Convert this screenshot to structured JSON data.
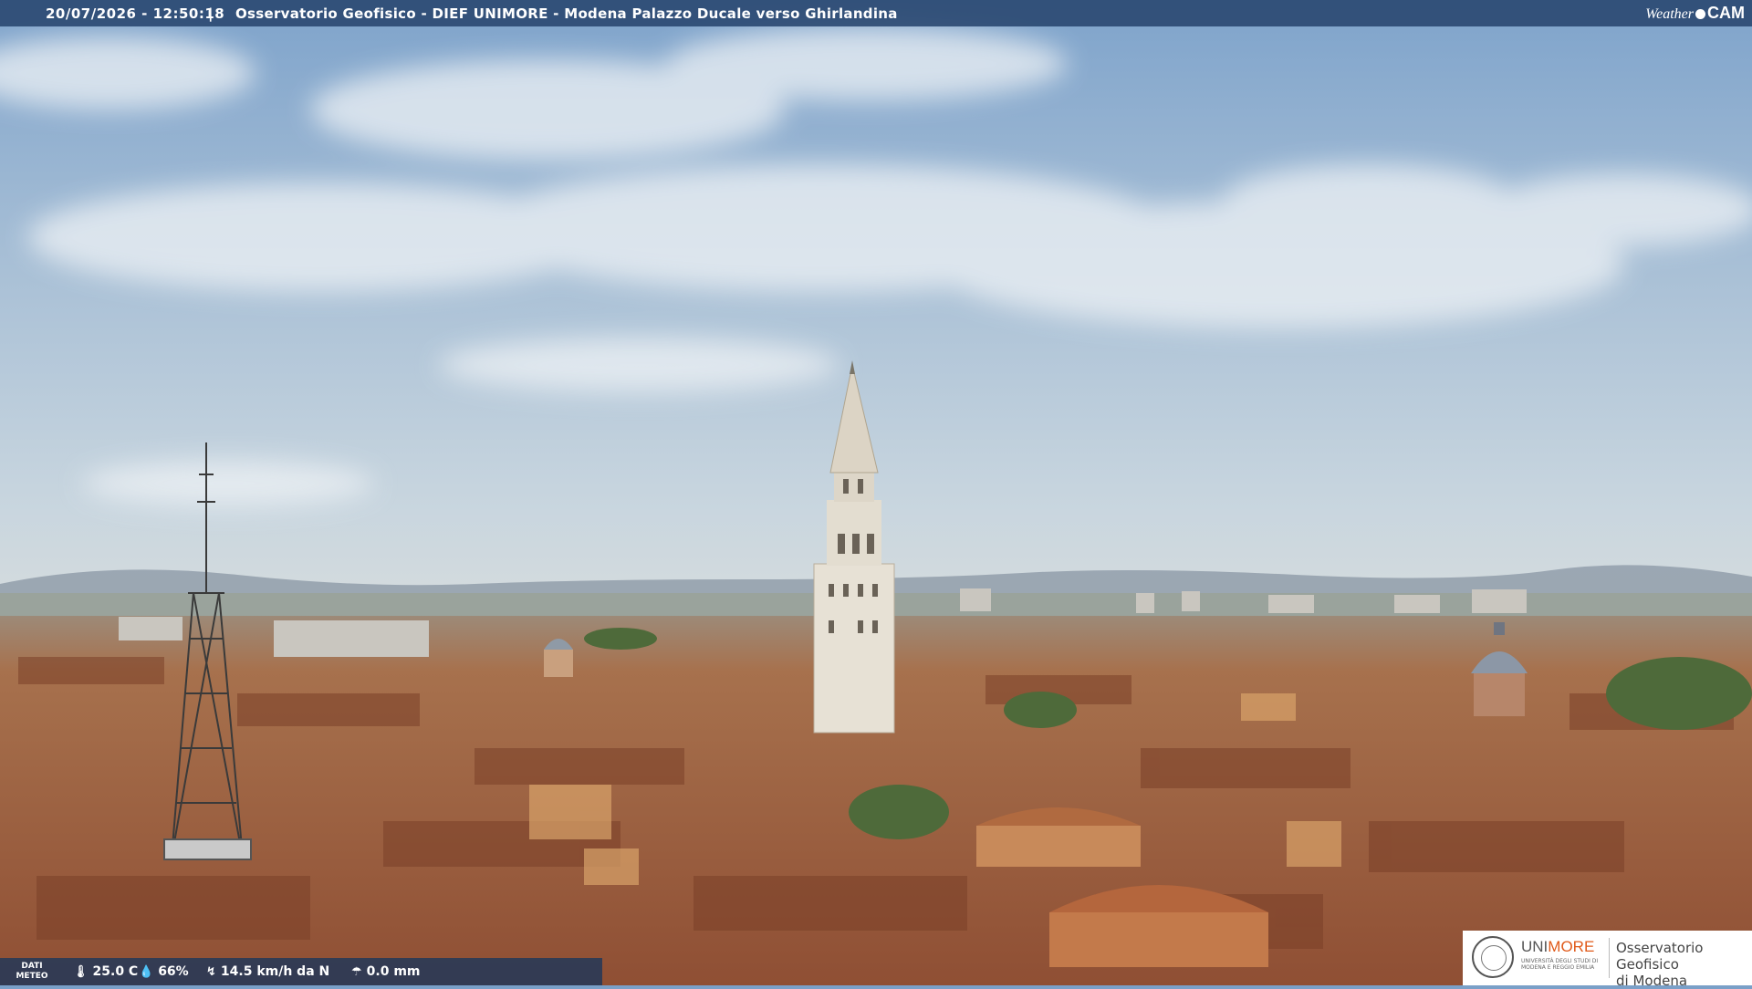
{
  "overlay": {
    "timestamp": "20/07/2026 - 12:50:18",
    "separator": "|",
    "title": "Osservatorio Geofisico - DIEF UNIMORE - Modena Palazzo Ducale verso Ghirlandina",
    "brand_weather": "Weather",
    "brand_cam": "CAM"
  },
  "weather": {
    "label_line1": "DATI",
    "label_line2": "METEO",
    "temperature": "25.0 C",
    "humidity": "66%",
    "wind": "14.5 km/h da N",
    "rain": "0.0 mm",
    "icons": [
      "thermometer-icon",
      "humidity-drop-icon",
      "wind-icon",
      "rain-icon"
    ]
  },
  "logo": {
    "uni_prefix": "UNI",
    "uni_suffix": "MORE",
    "uni_subtitle": "UNIVERSITÀ DEGLI STUDI DI MODENA E REGGIO EMILIA",
    "observatory_line1": "Osservatorio Geofisico",
    "observatory_line2": "di Modena"
  },
  "colors": {
    "sky_top": "#7ea3cb",
    "sky_horizon": "#c9d6df",
    "roofs": "#b06a45",
    "tower": "#e8e2d6",
    "bar": "#28466e",
    "accent": "#e05a1a"
  }
}
